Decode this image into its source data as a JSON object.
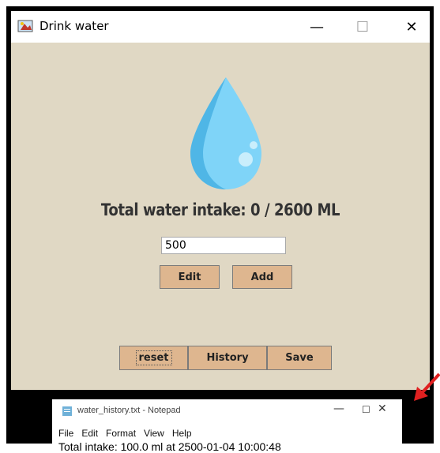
{
  "window": {
    "title": "Drink water",
    "minimize_glyph": "—",
    "maximize_glyph": "☐",
    "close_glyph": "✕"
  },
  "main": {
    "total_label": "Total water intake: 0 / 2600 ML",
    "input_value": "500",
    "edit_label": "Edit",
    "add_label": "Add",
    "reset_label": "reset",
    "history_label": "History",
    "save_label": "Save"
  },
  "notepad": {
    "title": "water_history.txt - Notepad",
    "menu": [
      "File",
      "Edit",
      "Format",
      "View",
      "Help"
    ],
    "minimize_glyph": "—",
    "maximize_glyph": "☐",
    "close_glyph": "✕",
    "first_line": "Total intake: 100.0 ml at 2500-01-04 10:00:48"
  },
  "colors": {
    "background": "#e0d8c4",
    "button": "#deb68f",
    "drop": "#5bc3f0",
    "arrow": "#e02020"
  },
  "icons": [
    "java-app-icon",
    "water-drop-icon",
    "notepad-icon",
    "red-arrow-icon"
  ]
}
